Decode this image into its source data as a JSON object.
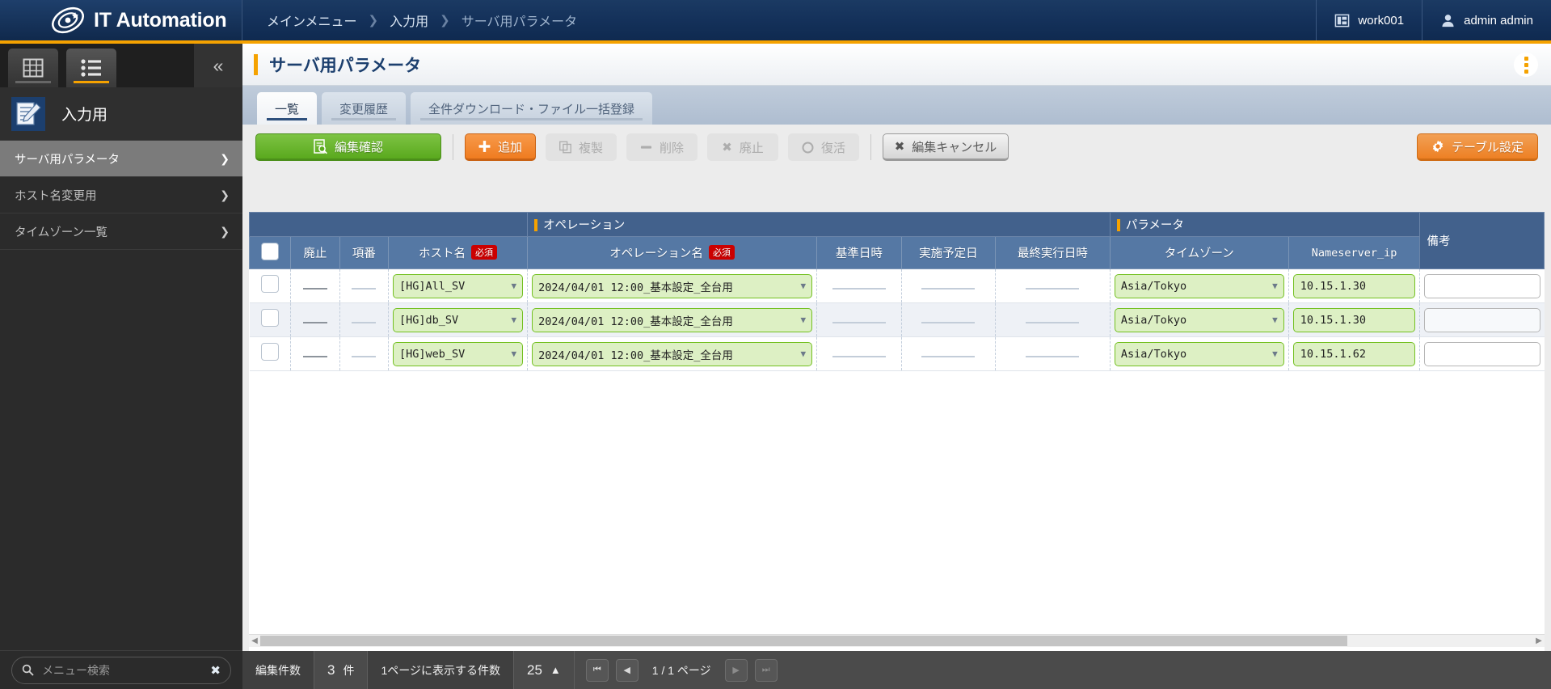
{
  "header": {
    "brand": "IT Automation",
    "breadcrumb": [
      "メインメニュー",
      "入力用",
      "サーバ用パラメータ"
    ],
    "workspace": "work001",
    "user": "admin admin",
    "workspace_icon": "window-icon",
    "user_icon": "person-icon"
  },
  "sidebar": {
    "tabs": [
      {
        "name": "grid-view-tab",
        "icon": "grid-icon",
        "active": false
      },
      {
        "name": "list-view-tab",
        "icon": "list-icon",
        "active": true
      }
    ],
    "collapse_icon": "chevron-double-left-icon",
    "group": {
      "label": "入力用",
      "icon": "notebook-pencil-icon"
    },
    "items": [
      {
        "label": "サーバ用パラメータ",
        "active": true
      },
      {
        "label": "ホスト名変更用",
        "active": false
      },
      {
        "label": "タイムゾーン一覧",
        "active": false
      }
    ],
    "search": {
      "placeholder": "メニュー検索",
      "value": "",
      "icon": "search-icon",
      "clear_icon": "close-icon"
    }
  },
  "page": {
    "title": "サーバ用パラメータ",
    "menu_icon": "kebab-menu-icon"
  },
  "tabs": [
    {
      "label": "一覧",
      "active": true
    },
    {
      "label": "変更履歴",
      "active": false
    },
    {
      "label": "全件ダウンロード・ファイル一括登録",
      "active": false
    }
  ],
  "toolbar": {
    "confirm_edit": {
      "label": "編集確認",
      "icon": "document-search-icon",
      "disabled": false
    },
    "add": {
      "label": "追加",
      "icon": "plus-icon",
      "disabled": false
    },
    "duplicate": {
      "label": "複製",
      "icon": "copy-icon",
      "disabled": true
    },
    "delete": {
      "label": "削除",
      "icon": "minus-icon",
      "disabled": true
    },
    "discard": {
      "label": "廃止",
      "icon": "x-icon",
      "disabled": true
    },
    "restore": {
      "label": "復活",
      "icon": "circle-icon",
      "disabled": true
    },
    "cancel_edit": {
      "label": "編集キャンセル",
      "icon": "x-icon",
      "disabled": false
    },
    "table_settings": {
      "label": "テーブル設定",
      "icon": "gear-icon",
      "disabled": false
    }
  },
  "table": {
    "groups": [
      {
        "label": "オペレーション",
        "accent": true
      },
      {
        "label": "パラメータ",
        "accent": true
      }
    ],
    "columns": [
      {
        "key": "check",
        "label": ""
      },
      {
        "key": "discard",
        "label": "廃止"
      },
      {
        "key": "seq",
        "label": "項番"
      },
      {
        "key": "hostname",
        "label": "ホスト名",
        "required": "必須"
      },
      {
        "key": "operation_name",
        "label": "オペレーション名",
        "required": "必須"
      },
      {
        "key": "base_datetime",
        "label": "基準日時"
      },
      {
        "key": "scheduled_date",
        "label": "実施予定日"
      },
      {
        "key": "last_exec_datetime",
        "label": "最終実行日時"
      },
      {
        "key": "timezone",
        "label": "タイムゾーン"
      },
      {
        "key": "nameserver_ip",
        "label": "Nameserver_ip"
      },
      {
        "key": "remarks",
        "label": "備考"
      }
    ],
    "rows": [
      {
        "hostname": "[HG]All_SV",
        "operation_name": "2024/04/01 12:00_基本設定_全台用",
        "base_datetime": "",
        "scheduled_date": "",
        "last_exec_datetime": "",
        "timezone": "Asia/Tokyo",
        "nameserver_ip": "10.15.1.30",
        "remarks": ""
      },
      {
        "hostname": "[HG]db_SV",
        "operation_name": "2024/04/01 12:00_基本設定_全台用",
        "base_datetime": "",
        "scheduled_date": "",
        "last_exec_datetime": "",
        "timezone": "Asia/Tokyo",
        "nameserver_ip": "10.15.1.30",
        "remarks": ""
      },
      {
        "hostname": "[HG]web_SV",
        "operation_name": "2024/04/01 12:00_基本設定_全台用",
        "base_datetime": "",
        "scheduled_date": "",
        "last_exec_datetime": "",
        "timezone": "Asia/Tokyo",
        "nameserver_ip": "10.15.1.62",
        "remarks": ""
      }
    ]
  },
  "footer": {
    "edit_count_label": "編集件数",
    "edit_count_value": "3",
    "edit_count_unit": "件",
    "per_page_label": "1ページに表示する件数",
    "per_page_value": "25",
    "per_page_caret": "▲",
    "page_text": "1 / 1 ページ",
    "first_icon": "first-page-icon",
    "prev_icon": "prev-page-icon",
    "next_icon": "next-page-icon",
    "last_icon": "last-page-icon"
  },
  "colors": {
    "brand_blue": "#14315a",
    "accent_orange": "#f5a200",
    "green": "#5aa91e",
    "required_red": "#cc0000",
    "header_blue": "#5578a4",
    "group_blue": "#42618c"
  }
}
